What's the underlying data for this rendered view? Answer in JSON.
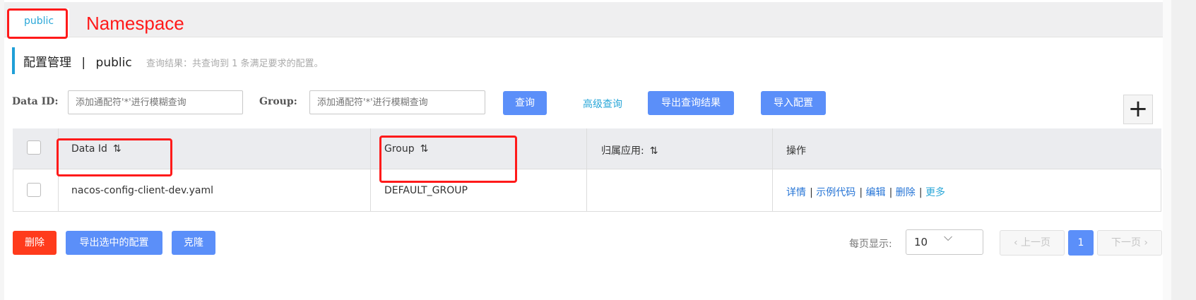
{
  "namespace": {
    "tab_label": "public",
    "annotation": "Namespace"
  },
  "header": {
    "title": "配置管理",
    "separator": "|",
    "namespace": "public",
    "result_text": "查询结果：共查询到 1 条满足要求的配置。"
  },
  "filters": {
    "data_id_label": "Data ID:",
    "data_id_placeholder": "添加通配符'*'进行模糊查询",
    "group_label": "Group:",
    "group_placeholder": "添加通配符'*'进行模糊查询",
    "query_button": "查询",
    "advanced_query": "高级查询",
    "export_results_button": "导出查询结果",
    "import_button": "导入配置",
    "add_icon": "plus-icon"
  },
  "table": {
    "headers": [
      "Data Id",
      "Group",
      "归属应用:",
      "操作"
    ],
    "sort_icon": "sort-icon",
    "rows": [
      {
        "data_id": "nacos-config-client-dev.yaml",
        "group": "DEFAULT_GROUP",
        "app": "",
        "actions": [
          "详情",
          "示例代码",
          "编辑",
          "删除",
          "更多"
        ]
      }
    ]
  },
  "bottom": {
    "delete_button": "删除",
    "export_selected_button": "导出选中的配置",
    "clone_button": "克隆",
    "page_size_label": "每页显示:",
    "page_size_value": "10",
    "prev_page": "上一页",
    "current_page": "1",
    "next_page": "下一页"
  },
  "colors": {
    "accent_blue": "#5b8ff9",
    "link_blue": "#2574d6",
    "danger_red": "#ff3b1c",
    "annotation_red": "#ff1a1a"
  }
}
